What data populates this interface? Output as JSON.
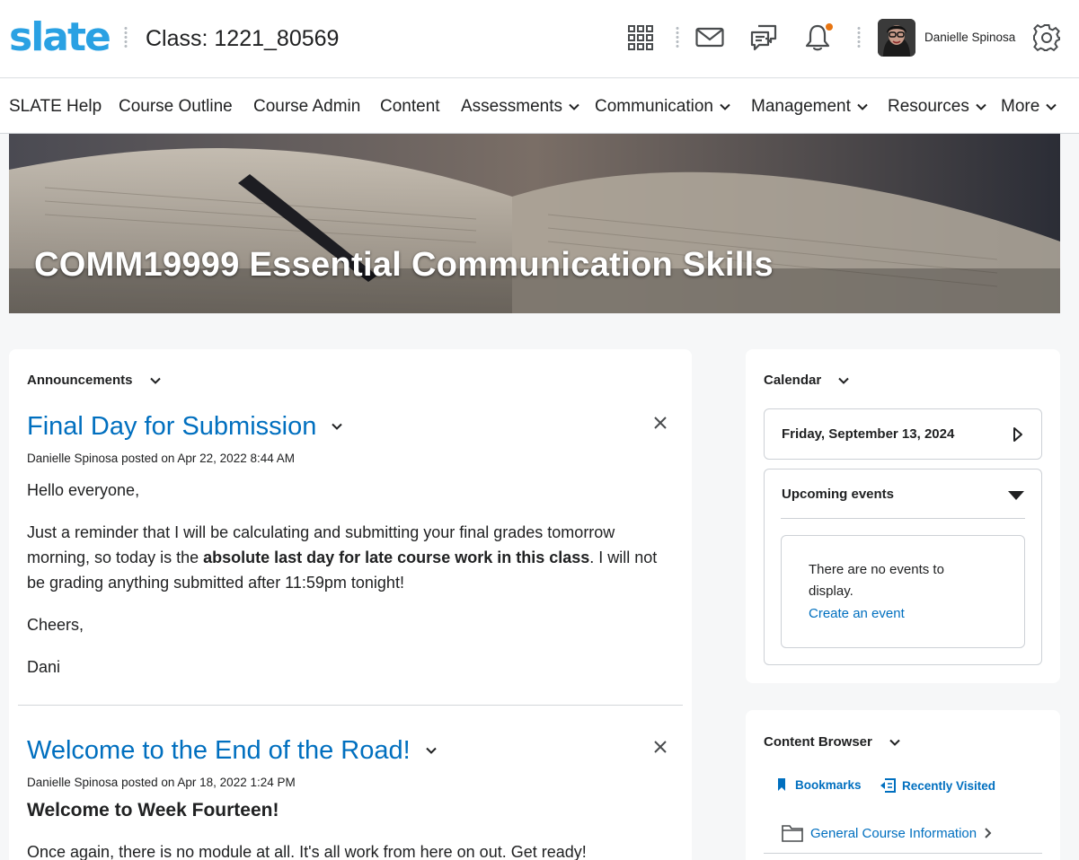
{
  "header": {
    "logo": "slate",
    "class_title": "Class: 1221_80569",
    "user_name": "Danielle Spinosa"
  },
  "nav": {
    "items": [
      {
        "label": "SLATE Help",
        "dropdown": false
      },
      {
        "label": "Course Outline",
        "dropdown": false
      },
      {
        "label": "Course Admin",
        "dropdown": false
      },
      {
        "label": "Content",
        "dropdown": false
      },
      {
        "label": "Assessments",
        "dropdown": true
      },
      {
        "label": "Communication",
        "dropdown": true
      },
      {
        "label": "Management",
        "dropdown": true
      },
      {
        "label": "Resources",
        "dropdown": true
      },
      {
        "label": "More",
        "dropdown": true
      }
    ]
  },
  "banner": {
    "course_title": "COMM19999 Essential Communication Skills"
  },
  "announcements": {
    "heading": "Announcements",
    "items": [
      {
        "title": "Final Day for Submission",
        "author": "Danielle Spinosa",
        "posted_text": "posted on Apr 22, 2022 8:44 AM",
        "greeting": "Hello everyone,",
        "para1_before": "Just a reminder that I will be calculating and submitting your final grades tomorrow morning, so today is the ",
        "para1_bold": "absolute last day for late course work in this class",
        "para1_after": ". I will not be grading anything submitted after 11:59pm tonight!",
        "signoff": "Cheers,",
        "signature": "Dani"
      },
      {
        "title": "Welcome to the End of the Road!",
        "author": "Danielle Spinosa",
        "posted_text": "posted on Apr 18, 2022 1:24 PM",
        "heading": "Welcome to Week Fourteen!",
        "body": "Once again, there is no module at all. It's all work from here on out. Get ready!"
      }
    ]
  },
  "calendar": {
    "heading": "Calendar",
    "date": "Friday, September 13, 2024",
    "upcoming_label": "Upcoming events",
    "no_events": "There are no events to display.",
    "create_link": "Create an event"
  },
  "content_browser": {
    "heading": "Content Browser",
    "bookmarks": "Bookmarks",
    "recently_visited": "Recently Visited",
    "module": "General Course Information"
  },
  "colors": {
    "link_blue": "#006fbf",
    "logo_blue": "#2aa1e3",
    "notification_dot": "#e87511"
  }
}
